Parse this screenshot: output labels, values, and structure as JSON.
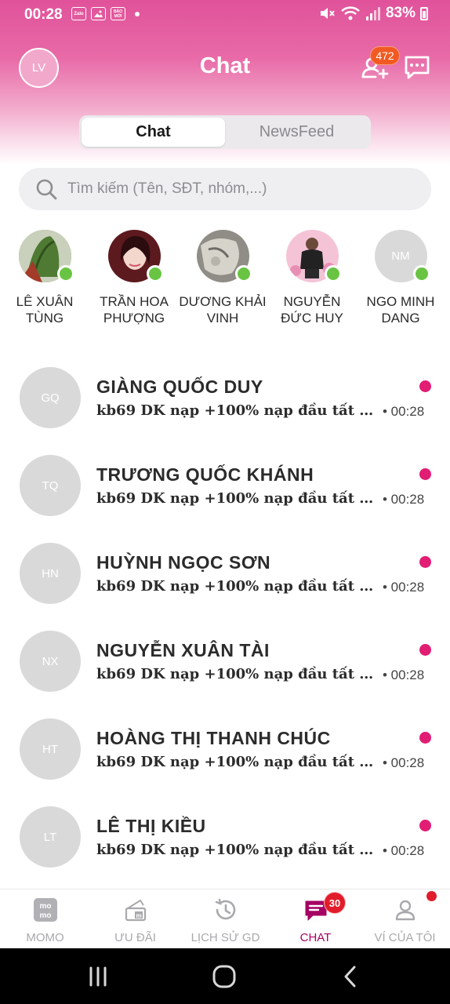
{
  "status_bar": {
    "time": "00:28",
    "app_icons": [
      "Zalo",
      "gallery",
      "BÁO MỚI"
    ],
    "battery": "83%"
  },
  "header": {
    "avatar_initials": "LV",
    "title": "Chat",
    "friend_requests_badge": "472"
  },
  "tabs": [
    {
      "label": "Chat",
      "active": true
    },
    {
      "label": "NewsFeed",
      "active": false
    }
  ],
  "search": {
    "placeholder": "Tìm kiếm (Tên, SĐT, nhóm,...)"
  },
  "stories": [
    {
      "name": "LÊ XUÂN TÙNG",
      "online": true
    },
    {
      "name": "TRẦN HOA PHƯỢNG",
      "online": true
    },
    {
      "name": "DƯƠNG KHẢI VINH",
      "online": true
    },
    {
      "name": "NGUYỄN ĐỨC HUY",
      "online": true
    },
    {
      "name": "NGO MINH DANG",
      "initials": "NM",
      "online": true
    }
  ],
  "chats": [
    {
      "initials": "GQ",
      "name": "GIÀNG QUỐC DUY",
      "message": "kb69 DK nạp +100% nạp đầu tất cả ...",
      "time": "• 00:28",
      "unread": true
    },
    {
      "initials": "TQ",
      "name": "TRƯƠNG QUỐC KHÁNH",
      "message": "kb69 DK nạp +100% nạp đầu tất cả ...",
      "time": "• 00:28",
      "unread": true
    },
    {
      "initials": "HN",
      "name": "HUỲNH NGỌC SƠN",
      "message": "kb69 DK nạp +100% nạp đầu tất cả ...",
      "time": "• 00:28",
      "unread": true
    },
    {
      "initials": "NX",
      "name": "NGUYỄN XUÂN TÀI",
      "message": "kb69 DK nạp +100% nạp đầu tất cả ...",
      "time": "• 00:28",
      "unread": true
    },
    {
      "initials": "HT",
      "name": "HOÀNG THỊ THANH CHÚC",
      "message": "kb69 DK nạp +100% nạp đầu tất cả ...",
      "time": "• 00:28",
      "unread": true
    },
    {
      "initials": "LT",
      "name": "LÊ THỊ KIỀU",
      "message": "kb69 DK nạp +100% nạp đầu tất cả...",
      "time": "• 00:28",
      "unread": true
    }
  ],
  "bottom_nav": [
    {
      "label": "MOMO",
      "icon": "momo-logo-icon",
      "active": false
    },
    {
      "label": "ƯU ĐÃI",
      "icon": "gift-ticket-icon",
      "active": false
    },
    {
      "label": "LỊCH SỬ GD",
      "icon": "history-icon",
      "active": false
    },
    {
      "label": "CHAT",
      "icon": "chat-bubble-icon",
      "active": true,
      "badge": "30"
    },
    {
      "label": "VÍ CỦA TÔI",
      "icon": "user-icon",
      "active": false,
      "dot": true
    }
  ],
  "colors": {
    "brand": "#a50064",
    "header_pink": "#e0529a",
    "unread": "#e11d74",
    "online": "#6ac443",
    "badge_orange": "#f15a22"
  }
}
